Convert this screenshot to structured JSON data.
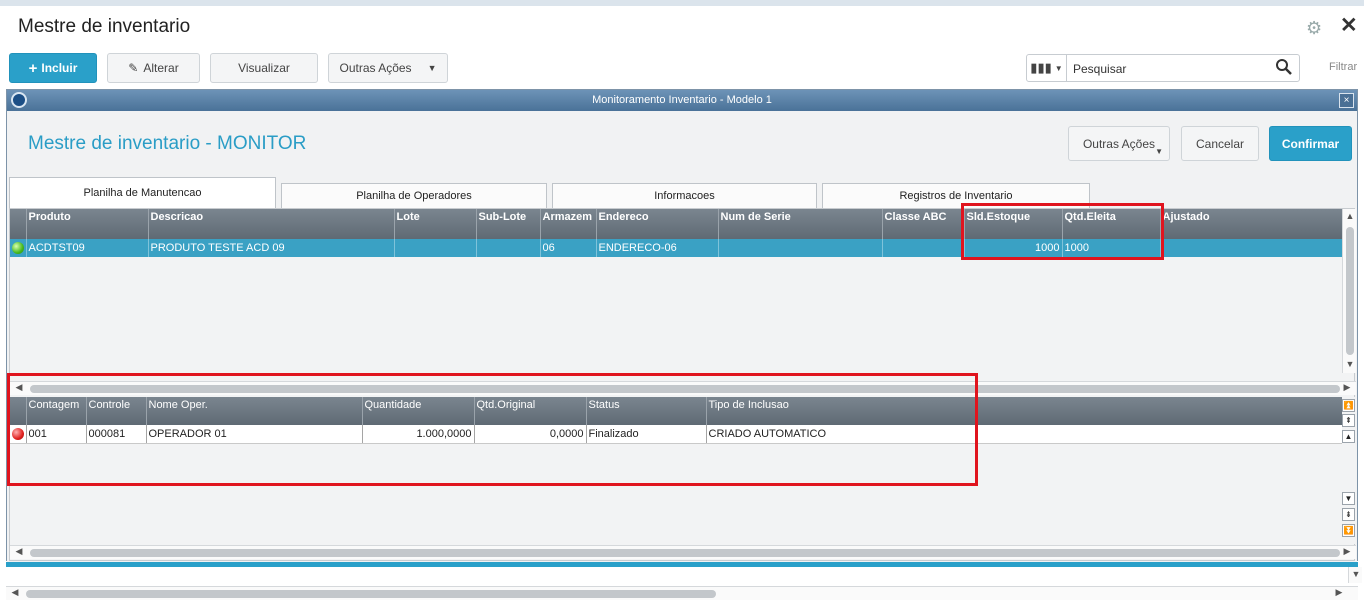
{
  "app": {
    "title": "Mestre de inventario"
  },
  "toolbar": {
    "incluir": "Incluir",
    "alterar": "Alterar",
    "visualizar": "Visualizar",
    "outras_acoes": "Outras Ações",
    "search_placeholder": "Pesquisar",
    "filtrar": "Filtrar"
  },
  "dialog": {
    "window_title": "Monitoramento Inventario - Modelo 1",
    "close_glyph": "×",
    "heading": "Mestre de inventario - MONITOR",
    "buttons": {
      "outras_acoes": "Outras Ações",
      "cancelar": "Cancelar",
      "confirmar": "Confirmar"
    },
    "tabs": [
      "Planilha de Manutencao",
      "Planilha de Operadores",
      "Informacoes",
      "Registros de Inventario"
    ],
    "active_tab": 0
  },
  "top_grid": {
    "columns": [
      "Produto",
      "Descricao",
      "Lote",
      "Sub-Lote",
      "Armazem",
      "Endereco",
      "Num de Serie",
      "Classe ABC",
      "Sld.Estoque",
      "Qtd.Eleita",
      "Ajustado"
    ],
    "rows": [
      {
        "status": "green",
        "cells": [
          "ACDTST09",
          "PRODUTO TESTE ACD 09",
          "",
          "",
          "06",
          "ENDERECO-06",
          "",
          "",
          "1000",
          "1000",
          ""
        ]
      }
    ]
  },
  "bottom_grid": {
    "columns": [
      "Contagem",
      "Controle",
      "Nome Oper.",
      "Quantidade",
      "Qtd.Original",
      "Status",
      "Tipo de Inclusao"
    ],
    "rows": [
      {
        "status": "red",
        "cells": [
          "001",
          "000081",
          "OPERADOR 01",
          "1.000,0000",
          "0,0000",
          "Finalizado",
          "CRIADO AUTOMATICO"
        ]
      }
    ]
  },
  "colors": {
    "accent": "#2aa0c9",
    "highlight": "#e0141e",
    "header": "#6c7780",
    "selected_row": "#3aa1c4"
  }
}
